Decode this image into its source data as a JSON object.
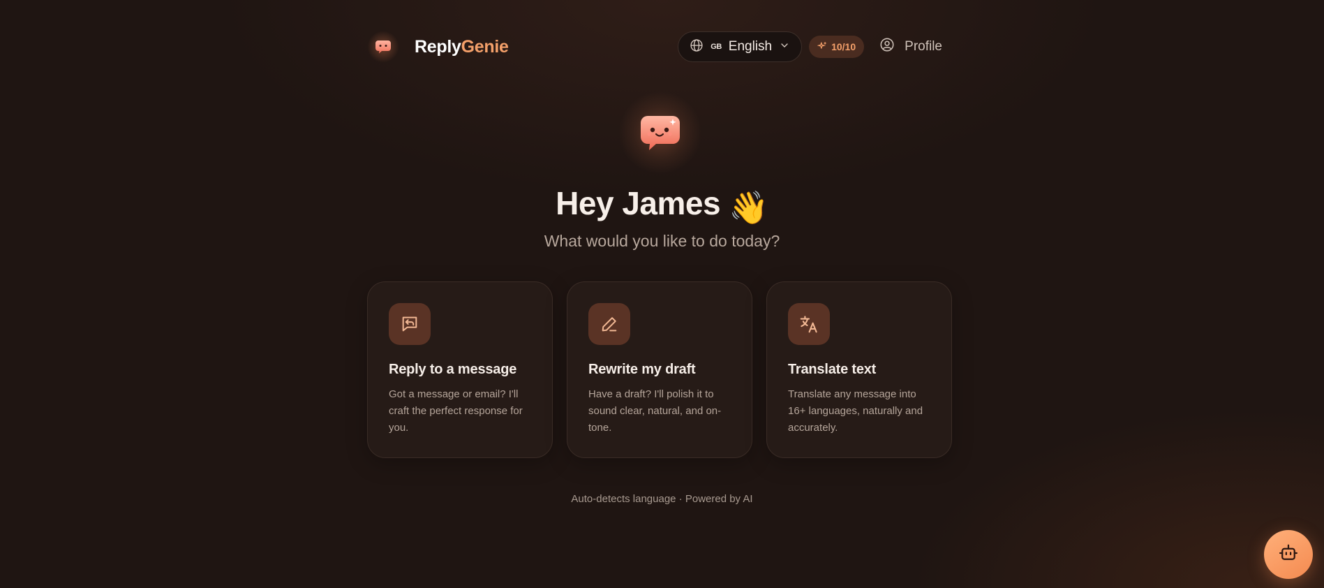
{
  "brand": {
    "name_part1": "Reply",
    "name_part2": "Genie"
  },
  "nav": {
    "language_flag": "GB",
    "language_label": "English",
    "credits": "10/10",
    "profile_label": "Profile"
  },
  "hero": {
    "greeting": "Hey James",
    "wave_emoji": "👋",
    "subtitle": "What would you like to do today?"
  },
  "cards": [
    {
      "icon": "message-reply-icon",
      "title": "Reply to a message",
      "description": "Got a message or email? I'll craft the perfect response for you."
    },
    {
      "icon": "pencil-icon",
      "title": "Rewrite my draft",
      "description": "Have a draft? I'll polish it to sound clear, natural, and on-tone."
    },
    {
      "icon": "translate-icon",
      "title": "Translate text",
      "description": "Translate any message into 16+ languages, naturally and accurately."
    }
  ],
  "footer": {
    "note": "Auto-detects language · Powered by AI"
  },
  "colors": {
    "background": "#1f1512",
    "card": "#261b17",
    "accent": "#f4a06a",
    "icon_tile": "#5a3325",
    "fab": "#f48a50"
  }
}
